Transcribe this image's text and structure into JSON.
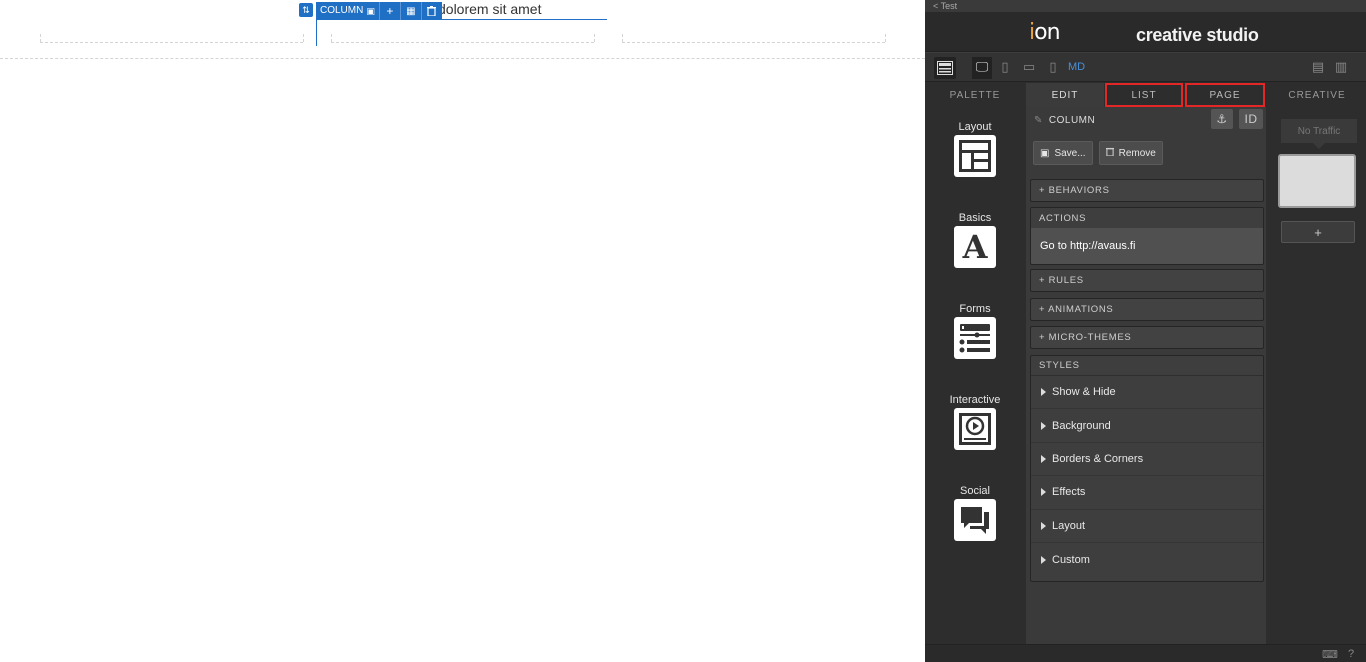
{
  "canvas": {
    "text": "dolorem sit amet",
    "column_label": "COLUMN"
  },
  "studio": {
    "back_link": "< Test",
    "logo_text": "ion",
    "title": "creative studio",
    "device_size": "MD",
    "tabs": {
      "palette": "PALETTE",
      "edit": "EDIT",
      "list": "LIST",
      "page": "PAGE",
      "creative": "CREATIVE"
    },
    "palette": [
      {
        "label": "Layout",
        "icon": "layout-icon"
      },
      {
        "label": "Basics",
        "icon": "text-a-icon"
      },
      {
        "label": "Forms",
        "icon": "form-icon"
      },
      {
        "label": "Interactive",
        "icon": "play-icon"
      },
      {
        "label": "Social",
        "icon": "chat-icon"
      }
    ],
    "edit": {
      "element": "COLUMN",
      "id_button": "ID",
      "save": "Save...",
      "remove": "Remove",
      "behaviors": "+ BEHAVIORS",
      "actions_header": "ACTIONS",
      "action_item": "Go to http://avaus.fi",
      "rules": "+ RULES",
      "animations": "+ ANIMATIONS",
      "micro_themes": "+ MICRO-THEMES",
      "styles_header": "STYLES",
      "styles": [
        "Show & Hide",
        "Background",
        "Borders & Corners",
        "Effects",
        "Layout",
        "Custom"
      ]
    },
    "creative": {
      "status": "No Traffic",
      "add": "+"
    }
  },
  "colors": {
    "accent_blue": "#1f6fc5",
    "highlight_red": "#e32626",
    "panel_bg": "#2d2d2d"
  }
}
